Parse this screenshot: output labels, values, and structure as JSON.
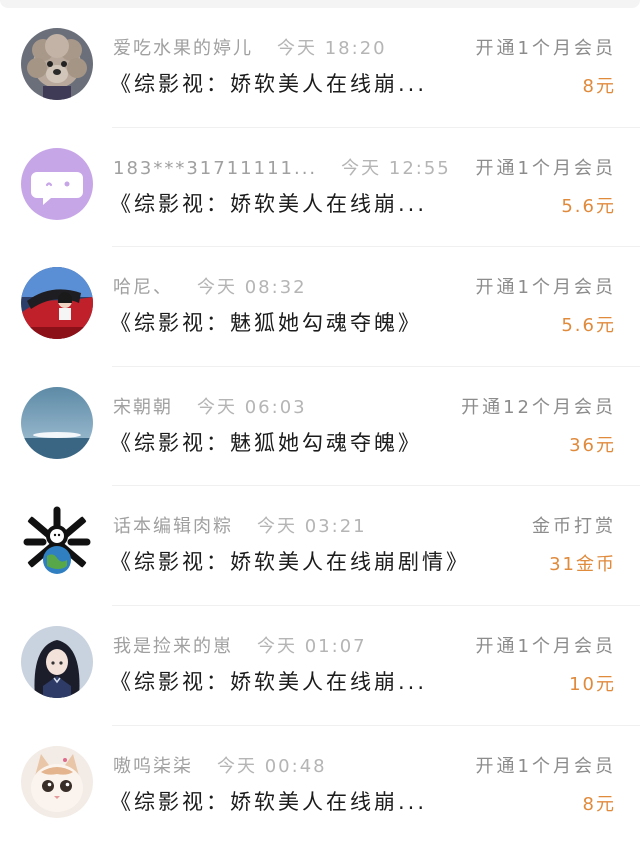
{
  "records": [
    {
      "name": "爱吃水果的婷儿",
      "time": "今天 18:20",
      "action": "开通1个月会员",
      "book": "《综影视：娇软美人在线崩...",
      "amount": "8元",
      "avatar": "poodle-avatar"
    },
    {
      "name": "183***31711111...",
      "time": "今天 12:55",
      "action": "开通1个月会员",
      "book": "《综影视：娇软美人在线崩...",
      "amount": "5.6元",
      "avatar": "default-chat-avatar"
    },
    {
      "name": "哈尼、",
      "time": "今天 08:32",
      "action": "开通1个月会员",
      "book": "《综影视：魅狐她勾魂夺魄》",
      "amount": "5.6元",
      "avatar": "car-girl-avatar"
    },
    {
      "name": "宋朝朝",
      "time": "今天 06:03",
      "action": "开通12个月会员",
      "book": "《综影视：魅狐她勾魂夺魄》",
      "amount": "36元",
      "avatar": "sea-horizon-avatar"
    },
    {
      "name": "话本编辑肉粽",
      "time": "今天 03:21",
      "action": "金币打赏",
      "book": "《综影视：娇软美人在线崩剧情》",
      "amount": "31金币",
      "avatar": "globe-bones-avatar"
    },
    {
      "name": "我是捡来的崽",
      "time": "今天 01:07",
      "action": "开通1个月会员",
      "book": "《综影视：娇软美人在线崩...",
      "amount": "10元",
      "avatar": "anime-girl-avatar"
    },
    {
      "name": "嗷呜柒柒",
      "time": "今天 00:48",
      "action": "开通1个月会员",
      "book": "《综影视：娇软美人在线崩...",
      "amount": "8元",
      "avatar": "kitten-avatar"
    }
  ],
  "colors": {
    "name_gray": "#a0a0a0",
    "action_gray": "#8c8c8c",
    "price_orange": "#e08a3c",
    "separator": "#f0f0f0"
  }
}
